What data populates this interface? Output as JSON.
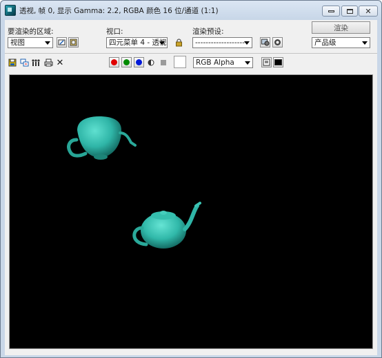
{
  "window": {
    "title": "透视, 帧 0, 显示 Gamma: 2.2, RGBA 颜色 16 位/通道 (1:1)"
  },
  "controls": {
    "area_label": "要渲染的区域:",
    "area_value": "视图",
    "viewport_label": "视口:",
    "viewport_value": "四元菜单 4 - 透视",
    "preset_label": "渲染预设:",
    "preset_value": "-------------------",
    "render_button": "渲染",
    "quality_value": "产品级",
    "channel_value": "RGB Alpha"
  },
  "colors": {
    "teapot": "#2fb5a7",
    "background": "#000000",
    "red_channel": "#e00000",
    "green_channel": "#008a00",
    "blue_channel": "#0018d8"
  }
}
